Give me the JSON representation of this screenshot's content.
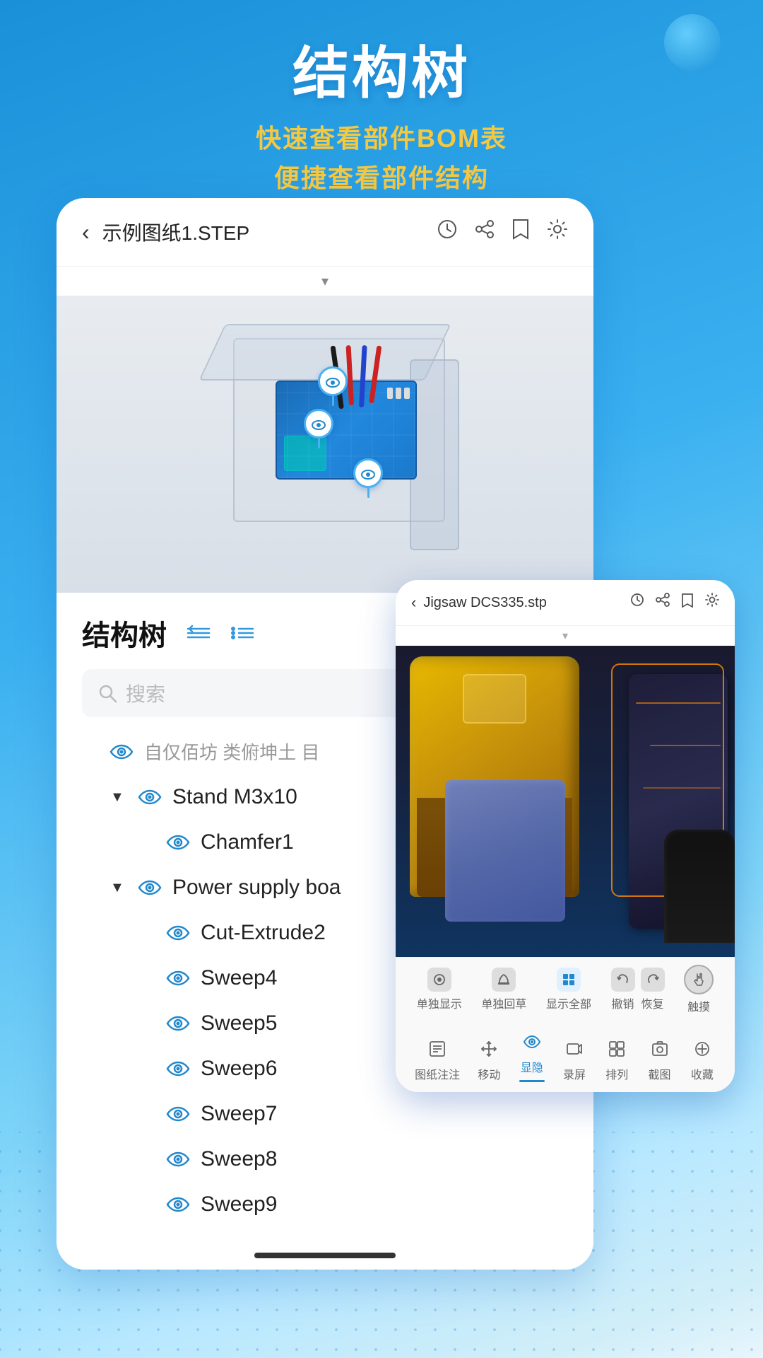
{
  "page": {
    "background": {
      "gradient_start": "#1a90d9",
      "gradient_end": "#e8f5fc"
    }
  },
  "header": {
    "main_title": "结构树",
    "subtitle_line1": "快速查看部件BOM表",
    "subtitle_line2": "便捷查看部件结构"
  },
  "main_card": {
    "back_label": "‹",
    "file_name": "示例图纸1.STEP",
    "icons": {
      "history": "🕐",
      "share": "⇗",
      "bookmark": "▣",
      "settings": "⚙"
    },
    "dropdown_arrow": "▾",
    "structure_tree": {
      "section_title": "结构树",
      "search_placeholder": "搜索",
      "expand_icon": "▼",
      "items": [
        {
          "level": 1,
          "expand": true,
          "text": "自仅佰坊 类俯坤土 目",
          "type": "parent",
          "visible": true
        },
        {
          "level": 2,
          "expand": true,
          "text": "Stand M3x10",
          "type": "parent",
          "visible": true
        },
        {
          "level": 3,
          "expand": false,
          "text": "Chamfer1",
          "type": "leaf",
          "visible": true
        },
        {
          "level": 2,
          "expand": true,
          "text": "Power supply boa",
          "type": "parent",
          "visible": true
        },
        {
          "level": 3,
          "expand": false,
          "text": "Cut-Extrude2",
          "type": "leaf",
          "visible": true
        },
        {
          "level": 3,
          "expand": false,
          "text": "Sweep4",
          "type": "leaf",
          "visible": true
        },
        {
          "level": 3,
          "expand": false,
          "text": "Sweep5",
          "type": "leaf",
          "visible": true
        },
        {
          "level": 3,
          "expand": false,
          "text": "Sweep6",
          "type": "leaf",
          "visible": true
        },
        {
          "level": 3,
          "expand": false,
          "text": "Sweep7",
          "type": "leaf",
          "visible": true
        },
        {
          "level": 3,
          "expand": false,
          "text": "Sweep8",
          "type": "leaf",
          "visible": true
        },
        {
          "level": 3,
          "expand": false,
          "text": "Sweep9",
          "type": "leaf",
          "visible": true
        }
      ]
    },
    "home_bar": "—"
  },
  "second_card": {
    "back_label": "‹",
    "file_name": "Jigsaw DCS335.stp",
    "icons": {
      "history": "🕐",
      "share": "⇗",
      "bookmark": "▣",
      "settings": "⚙"
    },
    "dropdown_arrow": "▾",
    "toolbar_top": [
      {
        "label": "单独显示",
        "icon": "◎",
        "active": false
      },
      {
        "label": "单独回草",
        "icon": "✎",
        "active": false
      },
      {
        "label": "显示全部",
        "icon": "⊞",
        "active": false
      },
      {
        "label": "撤销",
        "icon": "↺",
        "active": false
      },
      {
        "label": "恢复",
        "icon": "↻",
        "active": false
      },
      {
        "label": "触摸",
        "icon": "☞",
        "active": false
      }
    ],
    "toolbar_bottom": [
      {
        "label": "图纸注注",
        "icon": "📋",
        "active": false
      },
      {
        "label": "移动",
        "icon": "✥",
        "active": false
      },
      {
        "label": "显隐",
        "icon": "👁",
        "active": true
      },
      {
        "label": "录屏",
        "icon": "📹",
        "active": false
      },
      {
        "label": "排列",
        "icon": "⊞",
        "active": false
      },
      {
        "label": "截图",
        "icon": "✂",
        "active": false
      },
      {
        "label": "收藏",
        "icon": "⊕",
        "active": false
      }
    ]
  }
}
